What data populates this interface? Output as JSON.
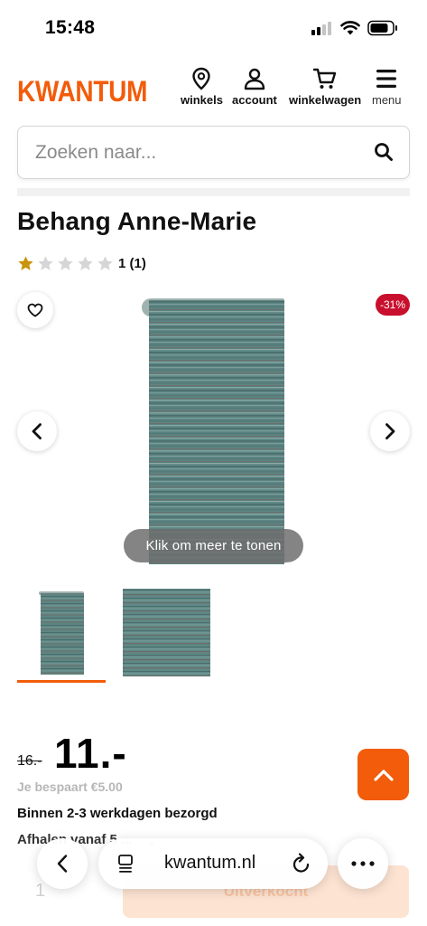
{
  "status_bar": {
    "time": "15:48"
  },
  "header": {
    "logo_text": "KWANTUM",
    "nav": [
      {
        "label": "winkels",
        "icon": "location-pin-icon"
      },
      {
        "label": "account",
        "icon": "user-icon"
      },
      {
        "label": "winkelwagen",
        "icon": "shopping-cart-icon"
      },
      {
        "label": "menu",
        "icon": "hamburger-menu-icon"
      }
    ]
  },
  "search": {
    "placeholder": "Zoeken naar...",
    "value": ""
  },
  "product": {
    "title": "Behang Anne-Marie",
    "rating": {
      "stars": 1,
      "max": 5,
      "count_label": "1 (1)"
    },
    "discount_badge": "-31%",
    "gallery_hint": "Klik om meer te tonen",
    "thumbnails": [
      "wallpaper-roll",
      "wallpaper-swatch"
    ],
    "old_price": "16.-",
    "price": "11.-",
    "saving": "Je bespaart €5.00",
    "delivery": "Binnen 2-3 werkdagen bezorgd",
    "pickup": "Afhalen vanaf 5 ...",
    "quantity": "1",
    "cart_label": "Uitverkocht"
  },
  "browser": {
    "url": "kwantum.nl"
  },
  "colors": {
    "brand": "#f25c0a",
    "discount": "#c8102e",
    "wallpaper": "#5d8583"
  }
}
